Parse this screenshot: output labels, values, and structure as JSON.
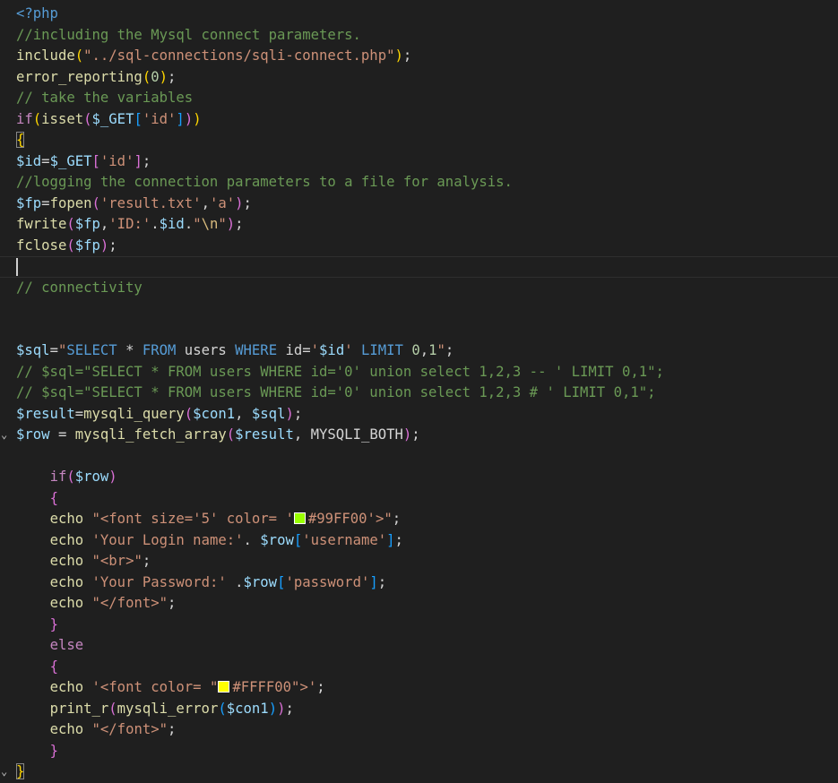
{
  "editor": {
    "lines": [
      {
        "tokens": [
          {
            "t": "<?php",
            "c": "#569cd6"
          }
        ]
      },
      {
        "tokens": [
          {
            "t": "//including the Mysql connect parameters.",
            "c": "#6a9955"
          }
        ]
      },
      {
        "tokens": [
          {
            "t": "include",
            "c": "#dcdcaa"
          },
          {
            "t": "(",
            "c": "#ffd700"
          },
          {
            "t": "\"../sql-connections/sqli-connect.php\"",
            "c": "#ce9178"
          },
          {
            "t": ")",
            "c": "#ffd700"
          },
          {
            "t": ";",
            "c": "#d4d4d4"
          }
        ]
      },
      {
        "tokens": [
          {
            "t": "error_reporting",
            "c": "#dcdcaa"
          },
          {
            "t": "(",
            "c": "#ffd700"
          },
          {
            "t": "0",
            "c": "#b5cea8"
          },
          {
            "t": ")",
            "c": "#ffd700"
          },
          {
            "t": ";",
            "c": "#d4d4d4"
          }
        ]
      },
      {
        "tokens": [
          {
            "t": "// take the variables",
            "c": "#6a9955"
          }
        ]
      },
      {
        "tokens": [
          {
            "t": "if",
            "c": "#c586c0"
          },
          {
            "t": "(",
            "c": "#ffd700"
          },
          {
            "t": "isset",
            "c": "#dcdcaa"
          },
          {
            "t": "(",
            "c": "#da70d6"
          },
          {
            "t": "$_GET",
            "c": "#9cdcfe"
          },
          {
            "t": "[",
            "c": "#179fff"
          },
          {
            "t": "'id'",
            "c": "#ce9178"
          },
          {
            "t": "]",
            "c": "#179fff"
          },
          {
            "t": ")",
            "c": "#da70d6"
          },
          {
            "t": ")",
            "c": "#ffd700"
          }
        ]
      },
      {
        "tokens": [
          {
            "t": "{",
            "c": "#ffd700",
            "box": true
          }
        ]
      },
      {
        "tokens": [
          {
            "t": "$id",
            "c": "#9cdcfe"
          },
          {
            "t": "=",
            "c": "#d4d4d4"
          },
          {
            "t": "$_GET",
            "c": "#9cdcfe"
          },
          {
            "t": "[",
            "c": "#da70d6"
          },
          {
            "t": "'id'",
            "c": "#ce9178"
          },
          {
            "t": "]",
            "c": "#da70d6"
          },
          {
            "t": ";",
            "c": "#d4d4d4"
          }
        ]
      },
      {
        "tokens": [
          {
            "t": "//logging the connection parameters to a file for analysis.",
            "c": "#6a9955"
          }
        ]
      },
      {
        "tokens": [
          {
            "t": "$fp",
            "c": "#9cdcfe"
          },
          {
            "t": "=",
            "c": "#d4d4d4"
          },
          {
            "t": "fopen",
            "c": "#dcdcaa"
          },
          {
            "t": "(",
            "c": "#da70d6"
          },
          {
            "t": "'result.txt'",
            "c": "#ce9178"
          },
          {
            "t": ",",
            "c": "#d4d4d4"
          },
          {
            "t": "'a'",
            "c": "#ce9178"
          },
          {
            "t": ")",
            "c": "#da70d6"
          },
          {
            "t": ";",
            "c": "#d4d4d4"
          }
        ]
      },
      {
        "tokens": [
          {
            "t": "fwrite",
            "c": "#dcdcaa"
          },
          {
            "t": "(",
            "c": "#da70d6"
          },
          {
            "t": "$fp",
            "c": "#9cdcfe"
          },
          {
            "t": ",",
            "c": "#d4d4d4"
          },
          {
            "t": "'ID:'",
            "c": "#ce9178"
          },
          {
            "t": ".",
            "c": "#d4d4d4"
          },
          {
            "t": "$id",
            "c": "#9cdcfe"
          },
          {
            "t": ".",
            "c": "#d4d4d4"
          },
          {
            "t": "\"",
            "c": "#ce9178"
          },
          {
            "t": "\\n",
            "c": "#d7ba7d"
          },
          {
            "t": "\"",
            "c": "#ce9178"
          },
          {
            "t": ")",
            "c": "#da70d6"
          },
          {
            "t": ";",
            "c": "#d4d4d4"
          }
        ]
      },
      {
        "tokens": [
          {
            "t": "fclose",
            "c": "#dcdcaa"
          },
          {
            "t": "(",
            "c": "#da70d6"
          },
          {
            "t": "$fp",
            "c": "#9cdcfe"
          },
          {
            "t": ")",
            "c": "#da70d6"
          },
          {
            "t": ";",
            "c": "#d4d4d4"
          }
        ]
      },
      {
        "tokens": [],
        "caret": true
      },
      {
        "tokens": [
          {
            "t": "// connectivity",
            "c": "#6a9955"
          }
        ]
      },
      {
        "tokens": []
      },
      {
        "tokens": []
      },
      {
        "tokens": [
          {
            "t": "$sql",
            "c": "#9cdcfe"
          },
          {
            "t": "=",
            "c": "#d4d4d4"
          },
          {
            "t": "\"",
            "c": "#ce9178"
          },
          {
            "t": "SELECT",
            "c": "#569cd6"
          },
          {
            "t": " * ",
            "c": "#d4d4d4"
          },
          {
            "t": "FROM",
            "c": "#569cd6"
          },
          {
            "t": " users ",
            "c": "#d4d4d4"
          },
          {
            "t": "WHERE",
            "c": "#569cd6"
          },
          {
            "t": " id=",
            "c": "#d4d4d4"
          },
          {
            "t": "'",
            "c": "#ce9178"
          },
          {
            "t": "$id",
            "c": "#9cdcfe"
          },
          {
            "t": "'",
            "c": "#ce9178"
          },
          {
            "t": " ",
            "c": "#d4d4d4"
          },
          {
            "t": "LIMIT",
            "c": "#569cd6"
          },
          {
            "t": " ",
            "c": "#d4d4d4"
          },
          {
            "t": "0",
            "c": "#b5cea8"
          },
          {
            "t": ",",
            "c": "#d4d4d4"
          },
          {
            "t": "1",
            "c": "#b5cea8"
          },
          {
            "t": "\"",
            "c": "#ce9178"
          },
          {
            "t": ";",
            "c": "#d4d4d4"
          }
        ]
      },
      {
        "tokens": [
          {
            "t": "// $sql=\"SELECT * FROM users WHERE id='0' union select 1,2,3 -- ' LIMIT 0,1\";",
            "c": "#6a9955"
          }
        ]
      },
      {
        "tokens": [
          {
            "t": "// $sql=\"SELECT * FROM users WHERE id='0' union select 1,2,3 # ' LIMIT 0,1\";",
            "c": "#6a9955"
          }
        ]
      },
      {
        "tokens": [
          {
            "t": "$result",
            "c": "#9cdcfe"
          },
          {
            "t": "=",
            "c": "#d4d4d4"
          },
          {
            "t": "mysqli_query",
            "c": "#dcdcaa"
          },
          {
            "t": "(",
            "c": "#da70d6"
          },
          {
            "t": "$con1",
            "c": "#9cdcfe"
          },
          {
            "t": ", ",
            "c": "#d4d4d4"
          },
          {
            "t": "$sql",
            "c": "#9cdcfe"
          },
          {
            "t": ")",
            "c": "#da70d6"
          },
          {
            "t": ";",
            "c": "#d4d4d4"
          }
        ]
      },
      {
        "tokens": [
          {
            "t": "$row",
            "c": "#9cdcfe"
          },
          {
            "t": " = ",
            "c": "#d4d4d4"
          },
          {
            "t": "mysqli_fetch_array",
            "c": "#dcdcaa"
          },
          {
            "t": "(",
            "c": "#da70d6"
          },
          {
            "t": "$result",
            "c": "#9cdcfe"
          },
          {
            "t": ", ",
            "c": "#d4d4d4"
          },
          {
            "t": "MYSQLI_BOTH",
            "c": "#d4d4d4"
          },
          {
            "t": ")",
            "c": "#da70d6"
          },
          {
            "t": ";",
            "c": "#d4d4d4"
          }
        ],
        "fold": "⌄"
      },
      {
        "tokens": []
      },
      {
        "tokens": [
          {
            "t": "    ",
            "c": "#d4d4d4"
          },
          {
            "t": "if",
            "c": "#c586c0"
          },
          {
            "t": "(",
            "c": "#da70d6"
          },
          {
            "t": "$row",
            "c": "#9cdcfe"
          },
          {
            "t": ")",
            "c": "#da70d6"
          }
        ]
      },
      {
        "tokens": [
          {
            "t": "    ",
            "c": "#d4d4d4"
          },
          {
            "t": "{",
            "c": "#da70d6"
          }
        ]
      },
      {
        "tokens": [
          {
            "t": "    ",
            "c": "#d4d4d4"
          },
          {
            "t": "echo",
            "c": "#dcdcaa"
          },
          {
            "t": " ",
            "c": "#d4d4d4"
          },
          {
            "t": "\"<font size='5' color= '",
            "c": "#ce9178"
          },
          {
            "swatch": "#99FF00"
          },
          {
            "t": "#99FF00'>\"",
            "c": "#ce9178"
          },
          {
            "t": ";",
            "c": "#d4d4d4"
          }
        ]
      },
      {
        "tokens": [
          {
            "t": "    ",
            "c": "#d4d4d4"
          },
          {
            "t": "echo",
            "c": "#dcdcaa"
          },
          {
            "t": " ",
            "c": "#d4d4d4"
          },
          {
            "t": "'Your Login name:'",
            "c": "#ce9178"
          },
          {
            "t": ". ",
            "c": "#d4d4d4"
          },
          {
            "t": "$row",
            "c": "#9cdcfe"
          },
          {
            "t": "[",
            "c": "#179fff"
          },
          {
            "t": "'username'",
            "c": "#ce9178"
          },
          {
            "t": "]",
            "c": "#179fff"
          },
          {
            "t": ";",
            "c": "#d4d4d4"
          }
        ]
      },
      {
        "tokens": [
          {
            "t": "    ",
            "c": "#d4d4d4"
          },
          {
            "t": "echo",
            "c": "#dcdcaa"
          },
          {
            "t": " ",
            "c": "#d4d4d4"
          },
          {
            "t": "\"<br>\"",
            "c": "#ce9178"
          },
          {
            "t": ";",
            "c": "#d4d4d4"
          }
        ]
      },
      {
        "tokens": [
          {
            "t": "    ",
            "c": "#d4d4d4"
          },
          {
            "t": "echo",
            "c": "#dcdcaa"
          },
          {
            "t": " ",
            "c": "#d4d4d4"
          },
          {
            "t": "'Your Password:'",
            "c": "#ce9178"
          },
          {
            "t": " .",
            "c": "#d4d4d4"
          },
          {
            "t": "$row",
            "c": "#9cdcfe"
          },
          {
            "t": "[",
            "c": "#179fff"
          },
          {
            "t": "'password'",
            "c": "#ce9178"
          },
          {
            "t": "]",
            "c": "#179fff"
          },
          {
            "t": ";",
            "c": "#d4d4d4"
          }
        ]
      },
      {
        "tokens": [
          {
            "t": "    ",
            "c": "#d4d4d4"
          },
          {
            "t": "echo",
            "c": "#dcdcaa"
          },
          {
            "t": " ",
            "c": "#d4d4d4"
          },
          {
            "t": "\"</font>\"",
            "c": "#ce9178"
          },
          {
            "t": ";",
            "c": "#d4d4d4"
          }
        ]
      },
      {
        "tokens": [
          {
            "t": "    ",
            "c": "#d4d4d4"
          },
          {
            "t": "}",
            "c": "#da70d6"
          }
        ]
      },
      {
        "tokens": [
          {
            "t": "    ",
            "c": "#d4d4d4"
          },
          {
            "t": "else",
            "c": "#c586c0"
          }
        ]
      },
      {
        "tokens": [
          {
            "t": "    ",
            "c": "#d4d4d4"
          },
          {
            "t": "{",
            "c": "#da70d6"
          }
        ]
      },
      {
        "tokens": [
          {
            "t": "    ",
            "c": "#d4d4d4"
          },
          {
            "t": "echo",
            "c": "#dcdcaa"
          },
          {
            "t": " ",
            "c": "#d4d4d4"
          },
          {
            "t": "'<font color= \"",
            "c": "#ce9178"
          },
          {
            "swatch": "#FFFF00"
          },
          {
            "t": "#FFFF00\">'",
            "c": "#ce9178"
          },
          {
            "t": ";",
            "c": "#d4d4d4"
          }
        ]
      },
      {
        "tokens": [
          {
            "t": "    ",
            "c": "#d4d4d4"
          },
          {
            "t": "print_r",
            "c": "#dcdcaa"
          },
          {
            "t": "(",
            "c": "#da70d6"
          },
          {
            "t": "mysqli_error",
            "c": "#dcdcaa"
          },
          {
            "t": "(",
            "c": "#179fff"
          },
          {
            "t": "$con1",
            "c": "#9cdcfe"
          },
          {
            "t": ")",
            "c": "#179fff"
          },
          {
            "t": ")",
            "c": "#da70d6"
          },
          {
            "t": ";",
            "c": "#d4d4d4"
          }
        ]
      },
      {
        "tokens": [
          {
            "t": "    ",
            "c": "#d4d4d4"
          },
          {
            "t": "echo",
            "c": "#dcdcaa"
          },
          {
            "t": " ",
            "c": "#d4d4d4"
          },
          {
            "t": "\"</font>\"",
            "c": "#ce9178"
          },
          {
            "t": ";",
            "c": "#d4d4d4"
          }
        ]
      },
      {
        "tokens": [
          {
            "t": "    ",
            "c": "#d4d4d4"
          },
          {
            "t": "}",
            "c": "#da70d6"
          }
        ]
      },
      {
        "tokens": [
          {
            "t": "}",
            "c": "#ffd700",
            "box": true
          }
        ],
        "fold": "⌄"
      }
    ]
  }
}
